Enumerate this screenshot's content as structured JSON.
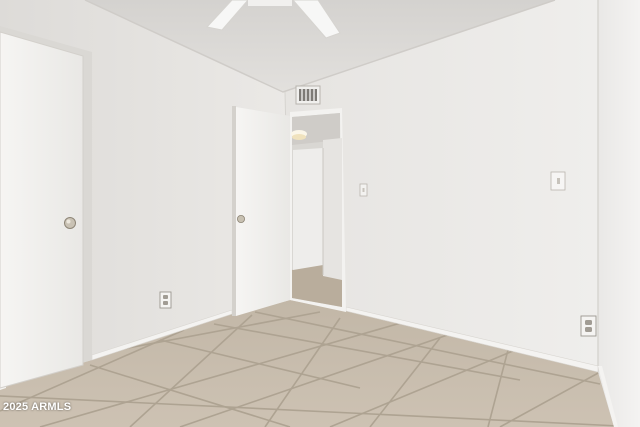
{
  "watermark": {
    "text": "2025 ARMLS"
  },
  "colors": {
    "ceiling": "#dedcd9",
    "left_wall": "#e8e6e3",
    "back_wall": "#e4e2df",
    "right_wall": "#eeedeb",
    "floor_tile": "#c7bcac",
    "grout": "#a89d8d",
    "baseboard": "#f4f3f1",
    "door": "#f2f1ef",
    "hallway": "#d3d1cd"
  },
  "icons": [
    "ceiling-fan-icon",
    "air-vent-icon",
    "ceiling-light-icon",
    "door-knob-icon",
    "light-switch-icon",
    "wall-outlet-icon"
  ]
}
